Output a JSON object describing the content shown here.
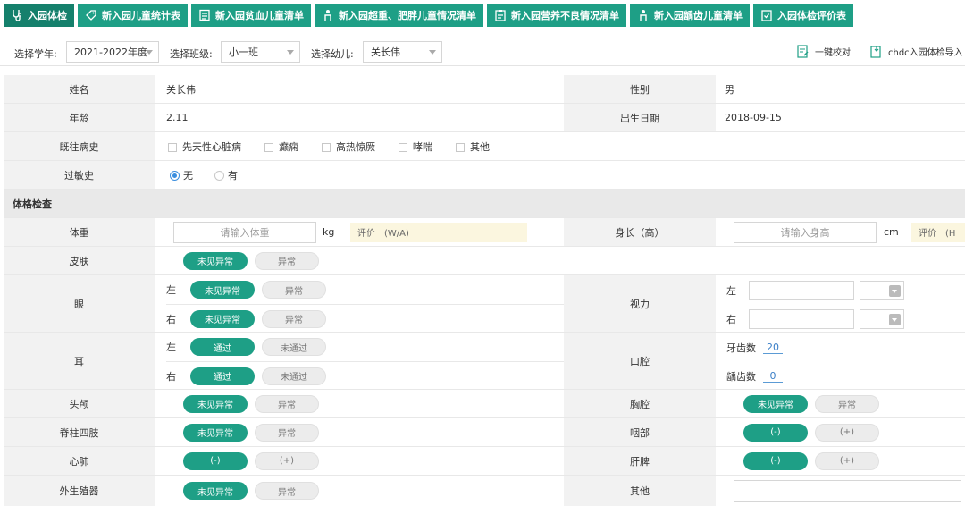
{
  "tabs": [
    {
      "label": "入园体检",
      "icon": "stethoscope-icon"
    },
    {
      "label": "新入园儿童统计表",
      "icon": "tag-icon"
    },
    {
      "label": "新入园贫血儿童清单",
      "icon": "list-icon"
    },
    {
      "label": "新入园超重、肥胖儿童情况清单",
      "icon": "person-icon"
    },
    {
      "label": "新入园营养不良情况清单",
      "icon": "clipboard-icon"
    },
    {
      "label": "新入园龋齿儿童清单",
      "icon": "person-icon"
    },
    {
      "label": "入园体检评价表",
      "icon": "clipboard-check-icon"
    }
  ],
  "filters": {
    "year_label": "选择学年:",
    "year_value": "2021-2022年度",
    "class_label": "选择班级:",
    "class_value": "小一班",
    "child_label": "选择幼儿:",
    "child_value": "关长伟",
    "check_btn": "一键校对",
    "import_btn": "chdc入园体检导入"
  },
  "info": {
    "name_label": "姓名",
    "name_value": "关长伟",
    "gender_label": "性别",
    "gender_value": "男",
    "age_label": "年龄",
    "age_value": "2.11",
    "birth_label": "出生日期",
    "birth_value": "2018-09-15",
    "history_label": "既往病史",
    "history_options": [
      "先天性心脏病",
      "癫痫",
      "高热惊厥",
      "哮喘",
      "其他"
    ],
    "allergy_label": "过敏史",
    "allergy_options": [
      "无",
      "有"
    ]
  },
  "exam": {
    "section_title": "体格检查",
    "weight_label": "体重",
    "weight_placeholder": "请输入体重",
    "weight_unit": "kg",
    "weight_eval": "评价　(W/A)",
    "height_label": "身长（高）",
    "height_placeholder": "请输入身高",
    "height_unit": "cm",
    "height_eval": "评价　(H",
    "skin_label": "皮肤",
    "eye_label": "眼",
    "ear_label": "耳",
    "head_label": "头颅",
    "spine_label": "脊柱四肢",
    "heartlung_label": "心肺",
    "genital_label": "外生殖器",
    "vision_label": "视力",
    "oral_label": "口腔",
    "chest_label": "胸腔",
    "throat_label": "咽部",
    "liver_label": "肝脾",
    "other_label": "其他",
    "left": "左",
    "right": "右",
    "normal": "未见异常",
    "abnormal": "异常",
    "pass": "通过",
    "fail": "未通过",
    "neg": "(-)",
    "pos": "(+)",
    "teeth_label": "牙齿数",
    "teeth_value": "20",
    "caries_label": "龋齿数",
    "caries_value": "0"
  },
  "colors": {
    "accent": "#1e9f86",
    "label_bg": "#f2f2f2"
  }
}
